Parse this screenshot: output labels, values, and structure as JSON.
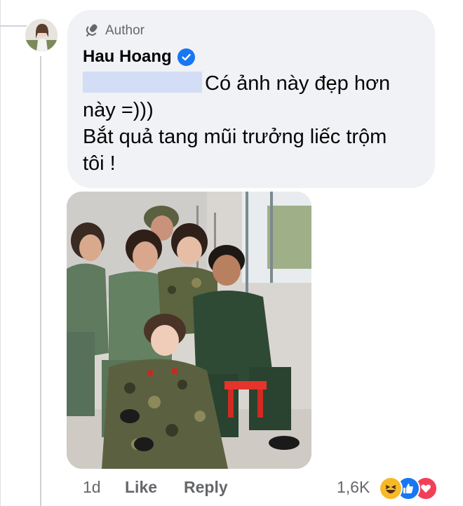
{
  "comment": {
    "author_badge_label": "Author",
    "author_name": "Hau Hoang",
    "line1": "Có ảnh này đẹp hơn",
    "line2": "này =)))",
    "line3": "Bắt quả tang mũi trưởng liếc trộm",
    "line4": "tôi !"
  },
  "footer": {
    "time": "1d",
    "like_label": "Like",
    "reply_label": "Reply",
    "reaction_count": "1,6K"
  },
  "reactions": [
    "haha",
    "like",
    "love"
  ],
  "colors": {
    "bubble": "#f0f2f5",
    "verified": "#1877f2",
    "secondary_text": "#65676b",
    "tag_highlight": "#d3ddf5"
  }
}
